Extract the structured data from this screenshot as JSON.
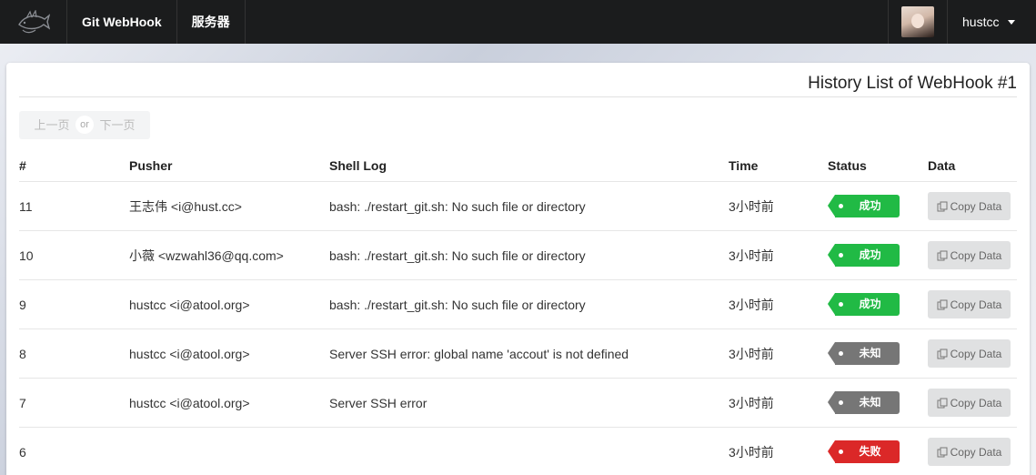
{
  "nav": {
    "items": [
      "Git WebHook",
      "服务器"
    ],
    "username": "hustcc"
  },
  "page": {
    "title": "History List of WebHook #1"
  },
  "pager": {
    "prev": "上一页",
    "or": "or",
    "next": "下一页"
  },
  "table": {
    "headers": [
      "#",
      "Pusher",
      "Shell Log",
      "Time",
      "Status",
      "Data"
    ],
    "copy_label": "Copy Data",
    "rows": [
      {
        "num": "11",
        "pusher": "王志伟 <i@hust.cc>",
        "log": "bash: ./restart_git.sh: No such file or directory",
        "time": "3小时前",
        "status": "成功",
        "status_type": "success"
      },
      {
        "num": "10",
        "pusher": "小薇 <wzwahl36@qq.com>",
        "log": "bash: ./restart_git.sh: No such file or directory",
        "time": "3小时前",
        "status": "成功",
        "status_type": "success"
      },
      {
        "num": "9",
        "pusher": "hustcc <i@atool.org>",
        "log": "bash: ./restart_git.sh: No such file or directory",
        "time": "3小时前",
        "status": "成功",
        "status_type": "success"
      },
      {
        "num": "8",
        "pusher": "hustcc <i@atool.org>",
        "log": "Server SSH error: global name 'accout' is not defined",
        "time": "3小时前",
        "status": "未知",
        "status_type": "unknown"
      },
      {
        "num": "7",
        "pusher": "hustcc <i@atool.org>",
        "log": "Server SSH error",
        "time": "3小时前",
        "status": "未知",
        "status_type": "unknown"
      },
      {
        "num": "6",
        "pusher": "",
        "log": "",
        "time": "3小时前",
        "status": "失败",
        "status_type": "fail"
      }
    ]
  },
  "colors": {
    "success": "#21ba45",
    "unknown": "#767676",
    "fail": "#db2828",
    "topbar": "#1b1c1d"
  }
}
